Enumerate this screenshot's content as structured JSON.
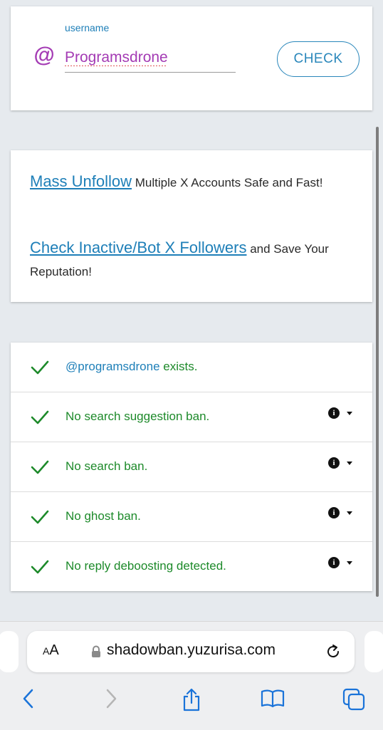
{
  "search": {
    "label": "username",
    "at_symbol": "@",
    "value": "Programsdrone",
    "button_label": "CHECK"
  },
  "promo": {
    "line1_link": "Mass Unfollow",
    "line1_text": " Multiple X Accounts Safe and Fast!",
    "line2_link": "Check Inactive/Bot X Followers",
    "line2_text": " and Save Your Reputation!"
  },
  "results": [
    {
      "handle": "@programsdrone",
      "text": " exists.",
      "has_info": false
    },
    {
      "handle": "",
      "text": "No search suggestion ban.",
      "has_info": true
    },
    {
      "handle": "",
      "text": "No search ban.",
      "has_info": true
    },
    {
      "handle": "",
      "text": "No ghost ban.",
      "has_info": true
    },
    {
      "handle": "",
      "text": "No reply deboosting detected.",
      "has_info": true
    }
  ],
  "browser": {
    "aa_label_small": "A",
    "aa_label_large": "A",
    "url": "shadowban.yuzurisa.com",
    "icons": [
      "lock-icon",
      "reload-icon",
      "back-icon",
      "forward-icon",
      "share-icon",
      "bookmarks-icon",
      "tabs-icon"
    ]
  },
  "colors": {
    "accent_blue": "#1e7fb8",
    "success_green": "#1d8a2a",
    "purple": "#a43bb4"
  }
}
